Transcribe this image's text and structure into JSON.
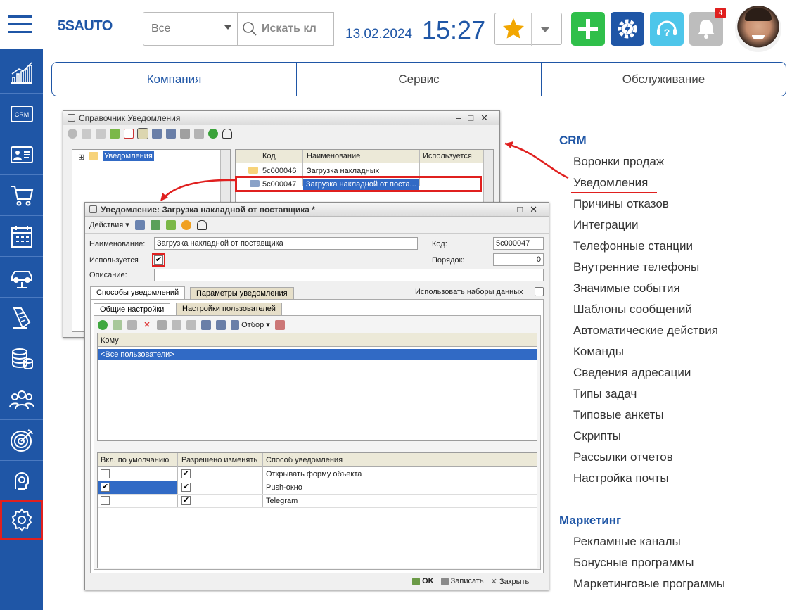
{
  "topbar": {
    "logo": "5SAUTO",
    "filter_value": "Все",
    "search_placeholder": "Искать кл",
    "date": "13.02.2024",
    "time": "15:27",
    "notification_count": "4"
  },
  "sidebar": {
    "items": [
      "analytics-icon",
      "crm-icon",
      "contacts-icon",
      "cart-icon",
      "calendar-icon",
      "service-lift-icon",
      "documents-icon",
      "database-icon",
      "team-icon",
      "target-icon",
      "support-icon",
      "settings-icon"
    ],
    "crm_label": "CRM"
  },
  "tabs": [
    "Компания",
    "Сервис",
    "Обслуживание"
  ],
  "right_menu": {
    "crm_title": "CRM",
    "crm_items": [
      "Воронки продаж",
      "Уведомления",
      "Причины отказов",
      "Интеграции",
      "Телефонные станции",
      "Внутренние телефоны",
      "Значимые события",
      "Шаблоны сообщений",
      "Автоматические действия",
      "Команды",
      "Сведения адресации",
      "Типы задач",
      "Типовые анкеты",
      "Скрипты",
      "Рассылки отчетов",
      "Настройка почты"
    ],
    "marketing_title": "Маркетинг",
    "marketing_items": [
      "Рекламные каналы",
      "Бонусные программы",
      "Маркетинговые программы"
    ]
  },
  "catalog_window": {
    "title": "Справочник Уведомления",
    "tree_root": "Уведомления",
    "columns": [
      "Код",
      "Наименование",
      "Используется"
    ],
    "rows": [
      {
        "code": "5c000046",
        "name": "Загрузка накладных",
        "used": ""
      },
      {
        "code": "5c000047",
        "name": "Загрузка накладной от поста...",
        "used": ""
      }
    ]
  },
  "item_window": {
    "title": "Уведомление: Загрузка накладной от поставщика *",
    "actions_label": "Действия",
    "name_label": "Наименование:",
    "name_value": "Загрузка накладной от поставщика",
    "code_label": "Код:",
    "code_value": "5c000047",
    "used_label": "Используется",
    "order_label": "Порядок:",
    "order_value": "0",
    "desc_label": "Описание:",
    "tab1": "Способы уведомлений",
    "tab2": "Параметры уведомления",
    "use_datasets_label": "Использовать наборы данных",
    "subtab1": "Общие настройки",
    "subtab2": "Настройки пользователей",
    "filter_label": "Отбор",
    "whom_header": "Кому",
    "whom_row": "<Все пользователи>",
    "method_columns": [
      "Вкл. по умолчанию",
      "Разрешено изменять",
      "Способ уведомления"
    ],
    "method_rows": [
      {
        "enabled": "",
        "allowed": "✔",
        "method": "Открывать форму объекта"
      },
      {
        "enabled": "✔",
        "allowed": "✔",
        "method": "Push-окно"
      },
      {
        "enabled": "",
        "allowed": "✔",
        "method": "Telegram"
      }
    ],
    "ok_label": "OK",
    "save_label": "Записать",
    "close_label": "Закрыть"
  }
}
